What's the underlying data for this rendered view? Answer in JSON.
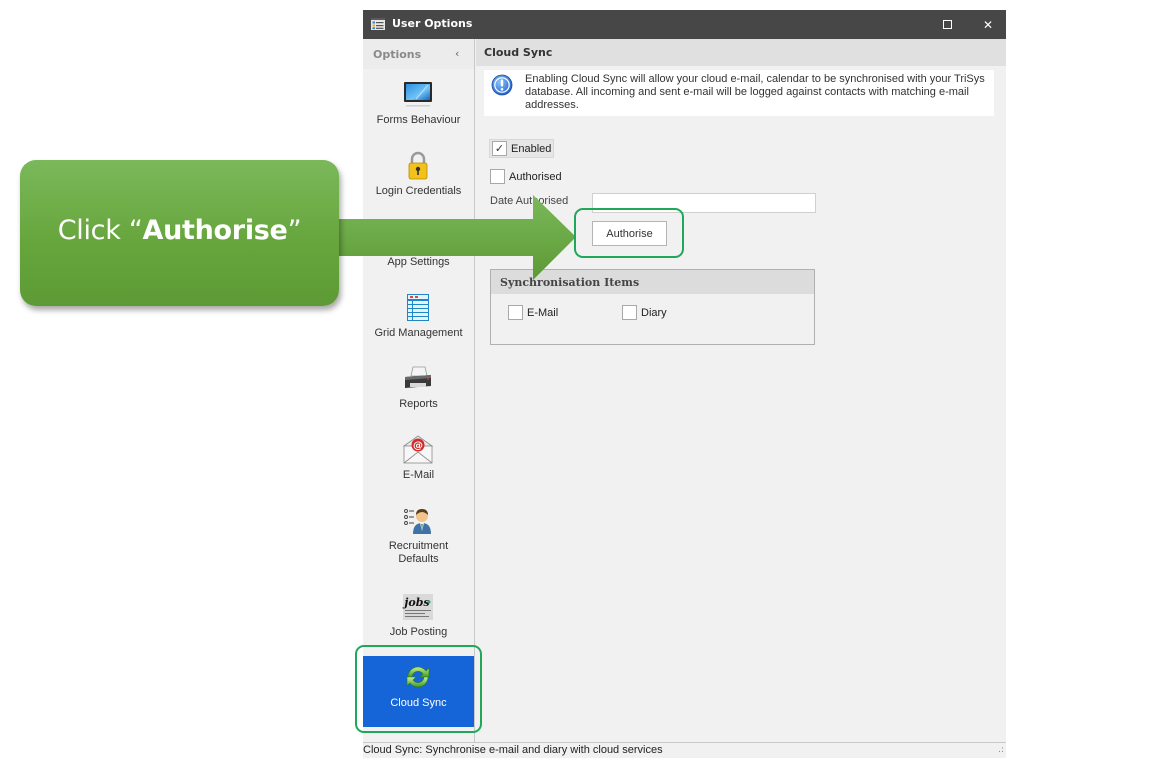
{
  "window": {
    "title": "User Options",
    "maximize_label": "maximize",
    "close_label": "✕"
  },
  "sidebar": {
    "header": "Options",
    "collapse_glyph": "‹",
    "items": [
      {
        "label": "Forms Behaviour",
        "icon": "monitor-icon"
      },
      {
        "label": "Login Credentials",
        "icon": "padlock-icon"
      },
      {
        "label": "App Settings",
        "icon": "settings-icon"
      },
      {
        "label": "Grid Management",
        "icon": "grid-icon"
      },
      {
        "label": "Reports",
        "icon": "printer-icon"
      },
      {
        "label": "E-Mail",
        "icon": "envelope-icon"
      },
      {
        "label": "Recruitment Defaults",
        "icon": "recruiter-icon"
      },
      {
        "label": "Job Posting",
        "icon": "jobs-newspaper-icon"
      },
      {
        "label": "Cloud Sync",
        "icon": "sync-arrows-icon",
        "active": true
      }
    ]
  },
  "content": {
    "header": "Cloud Sync",
    "info_text": "Enabling Cloud Sync will allow your cloud e-mail, calendar to be synchronised with your TriSys database. All incoming and sent e-mail will be logged against contacts with matching e-mail addresses.",
    "enabled": {
      "label": "Enabled",
      "checked": true,
      "check_glyph": "✓"
    },
    "authorised": {
      "label": "Authorised",
      "checked": false
    },
    "date_authorised": {
      "label": "Date Authorised",
      "value": ""
    },
    "authorise_button": "Authorise",
    "sync_items": {
      "header": "Synchronisation Items",
      "email": {
        "label": "E-Mail",
        "checked": false
      },
      "diary": {
        "label": "Diary",
        "checked": false
      }
    }
  },
  "statusbar": {
    "text": "Cloud Sync: Synchronise e-mail and diary with cloud services",
    "grip": ".:"
  },
  "annotation": {
    "prefix": "Click “",
    "emphasis": "Authorise",
    "suffix": "”",
    "color": "#6aa843",
    "highlight_color": "#1fa85a"
  },
  "colors": {
    "titlebar": "#474747",
    "active_nav": "#1565d8",
    "panel": "#f1f1f1"
  }
}
